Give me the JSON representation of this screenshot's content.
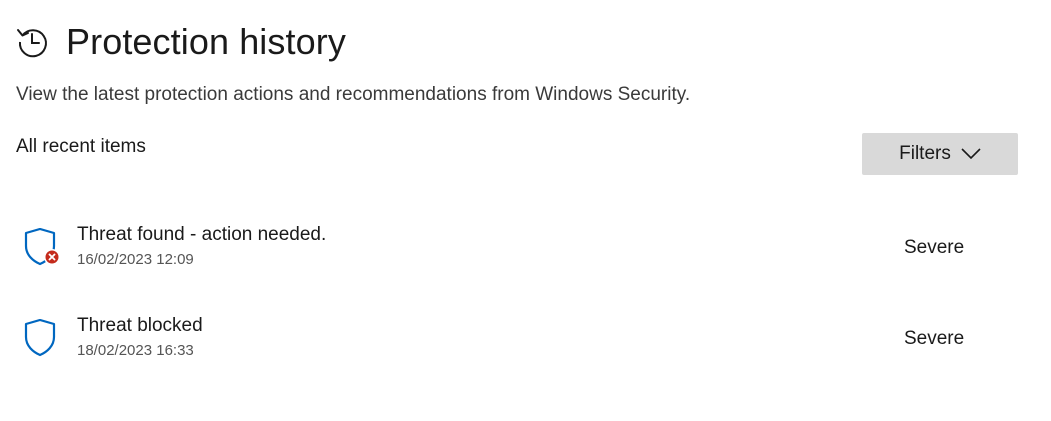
{
  "header": {
    "title": "Protection history",
    "icon": "history-icon"
  },
  "subtitle": "View the latest protection actions and recommendations from Windows Security.",
  "section_label": "All recent items",
  "filters": {
    "label": "Filters",
    "icon": "chevron-down-icon"
  },
  "items": [
    {
      "title": "Threat found - action needed.",
      "date": "16/02/2023 12:09",
      "severity": "Severe",
      "icon": "shield-error-icon"
    },
    {
      "title": "Threat blocked",
      "date": "18/02/2023 16:33",
      "severity": "Severe",
      "icon": "shield-icon"
    }
  ],
  "colors": {
    "shield_blue": "#0067c0",
    "error_red": "#c42b1c",
    "button_bg": "#d9d9d9"
  }
}
